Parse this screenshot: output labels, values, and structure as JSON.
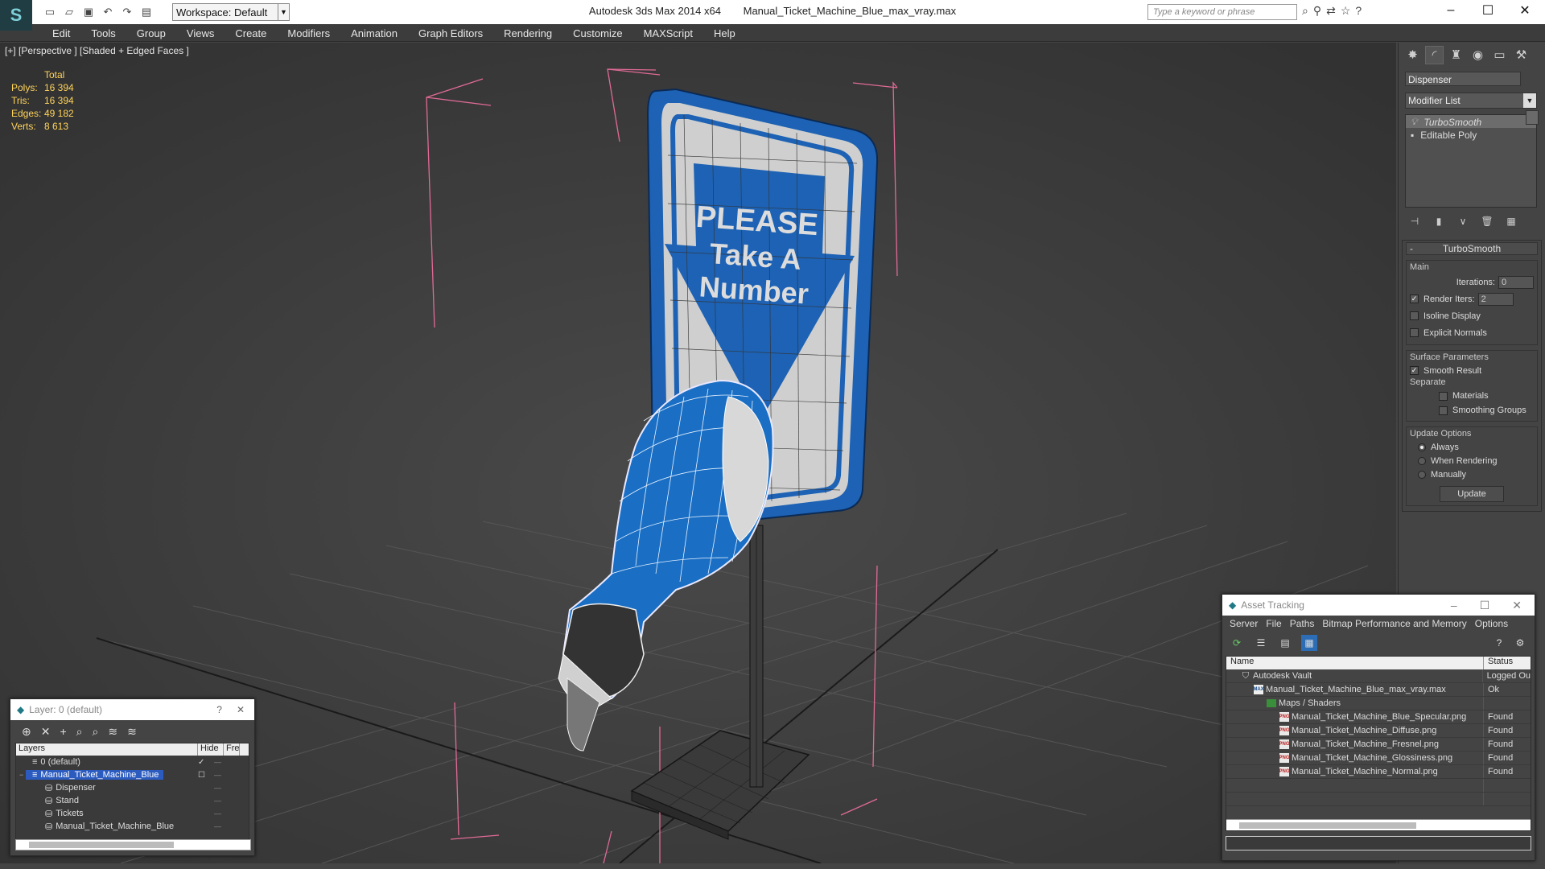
{
  "app": {
    "title": "Autodesk 3ds Max  2014 x64",
    "file": "Manual_Ticket_Machine_Blue_max_vray.max",
    "workspace": "Workspace: Default",
    "search_placeholder": "Type a keyword or phrase"
  },
  "menu": [
    "Edit",
    "Tools",
    "Group",
    "Views",
    "Create",
    "Modifiers",
    "Animation",
    "Graph Editors",
    "Rendering",
    "Customize",
    "MAXScript",
    "Help"
  ],
  "viewport": {
    "label": "[+] [Perspective ] [Shaded + Edged Faces ]",
    "stats": {
      "header": "Total",
      "rows": [
        {
          "k": "Polys:",
          "v": "16 394"
        },
        {
          "k": "Tris:",
          "v": "16 394"
        },
        {
          "k": "Edges:",
          "v": "49 182"
        },
        {
          "k": "Verts:",
          "v": "8 613"
        }
      ]
    },
    "sign_text": [
      "PLEASE",
      "Take A",
      "Number"
    ]
  },
  "command_panel": {
    "object_name": "Dispenser",
    "modifier_list": "Modifier List",
    "stack": [
      "TurboSmooth",
      "Editable Poly"
    ],
    "rollout": "TurboSmooth",
    "main_group": "Main",
    "iterations_label": "Iterations:",
    "iterations_value": "0",
    "render_iters_label": "Render Iters:",
    "render_iters_value": "2",
    "isoline": "Isoline Display",
    "explicit_normals": "Explicit Normals",
    "surface_group": "Surface Parameters",
    "smooth_result": "Smooth Result",
    "separate": "Separate",
    "materials": "Materials",
    "smoothing_groups": "Smoothing Groups",
    "update_group": "Update Options",
    "always": "Always",
    "when_rendering": "When Rendering",
    "manually": "Manually",
    "update_btn": "Update"
  },
  "layer_window": {
    "title": "Layer: 0 (default)",
    "help": "?",
    "col_layers": "Layers",
    "col_hide": "Hide",
    "col_freeze": "Fre",
    "rows": [
      {
        "name": "0 (default)",
        "indent": 1
      },
      {
        "name": "Manual_Ticket_Machine_Blue",
        "indent": 1
      },
      {
        "name": "Dispenser",
        "indent": 3
      },
      {
        "name": "Stand",
        "indent": 3
      },
      {
        "name": "Tickets",
        "indent": 3
      },
      {
        "name": "Manual_Ticket_Machine_Blue",
        "indent": 3
      }
    ]
  },
  "asset_tracking": {
    "title": "Asset Tracking",
    "menu": [
      "Server",
      "File",
      "Paths",
      "Bitmap Performance and Memory",
      "Options"
    ],
    "col_name": "Name",
    "col_status": "Status",
    "rows": [
      {
        "name": "Autodesk Vault",
        "status": "Logged Ou",
        "icon": "vault",
        "indent": 18
      },
      {
        "name": "Manual_Ticket_Machine_Blue_max_vray.max",
        "status": "Ok",
        "icon": "max",
        "indent": 34
      },
      {
        "name": "Maps / Shaders",
        "status": "",
        "icon": "folder",
        "indent": 50
      },
      {
        "name": "Manual_Ticket_Machine_Blue_Specular.png",
        "status": "Found",
        "icon": "png",
        "indent": 66
      },
      {
        "name": "Manual_Ticket_Machine_Diffuse.png",
        "status": "Found",
        "icon": "png",
        "indent": 66
      },
      {
        "name": "Manual_Ticket_Machine_Fresnel.png",
        "status": "Found",
        "icon": "png",
        "indent": 66
      },
      {
        "name": "Manual_Ticket_Machine_Glossiness.png",
        "status": "Found",
        "icon": "png",
        "indent": 66
      },
      {
        "name": "Manual_Ticket_Machine_Normal.png",
        "status": "Found",
        "icon": "png",
        "indent": 66
      }
    ]
  }
}
